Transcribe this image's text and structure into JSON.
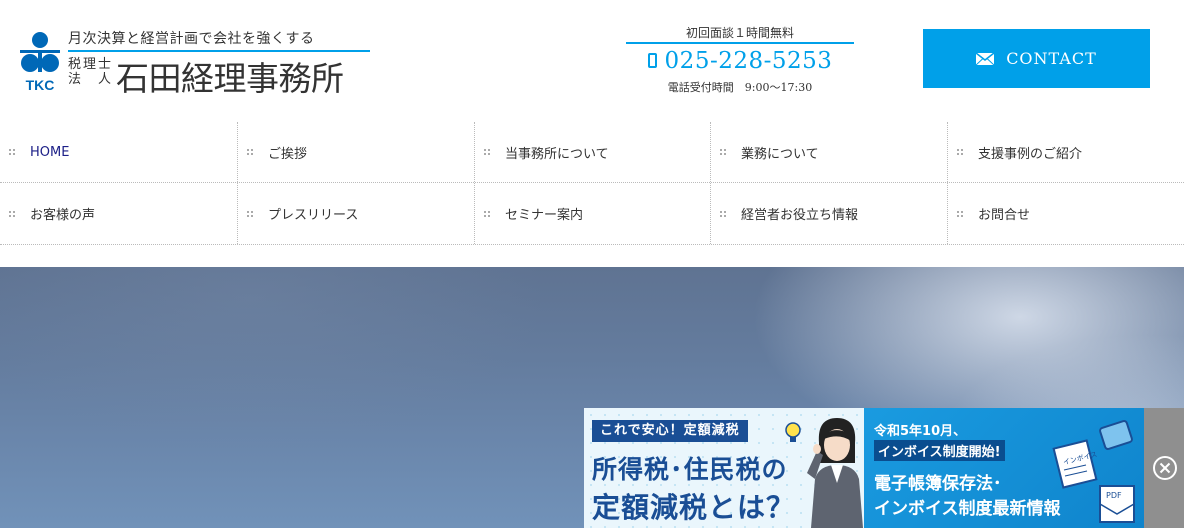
{
  "header": {
    "tagline": "月次決算と経営計画で会社を強くする",
    "logo_text": "TKC",
    "corp_type_line1": "税理士",
    "corp_type_line2": "法　人",
    "corp_name": "石田経理事務所",
    "consult_note": "初回面談１時間無料",
    "phone": "025-228-5253",
    "hours": "電話受付時間　9:00～17:30",
    "contact_label": "CONTACT"
  },
  "nav": {
    "row1": [
      {
        "label": "HOME"
      },
      {
        "label": "ご挨拶"
      },
      {
        "label": "当事務所について"
      },
      {
        "label": "業務について"
      },
      {
        "label": "支援事例のご紹介"
      }
    ],
    "row2": [
      {
        "label": "お客様の声"
      },
      {
        "label": "プレスリリース"
      },
      {
        "label": "セミナー案内"
      },
      {
        "label": "経営者お役立ち情報"
      },
      {
        "label": "お問合せ"
      }
    ]
  },
  "ad": {
    "badge": "これで安心！定額減税",
    "title1": "所得税･住民税の",
    "title2": "定額減税とは？",
    "right_line1": "令和5年10月、",
    "right_line2": "インボイス制度開始!",
    "right_line3": "電子帳簿保存法･",
    "right_line4": "インボイス制度最新情報",
    "doc_label1": "インボイス",
    "doc_label2": "PDF"
  },
  "colors": {
    "accent": "#00a0e9",
    "nav_active": "#1d2088",
    "logo_blue": "#0068b7",
    "ad_navy": "#1a4e95",
    "ad_blue": "#1490d6"
  }
}
